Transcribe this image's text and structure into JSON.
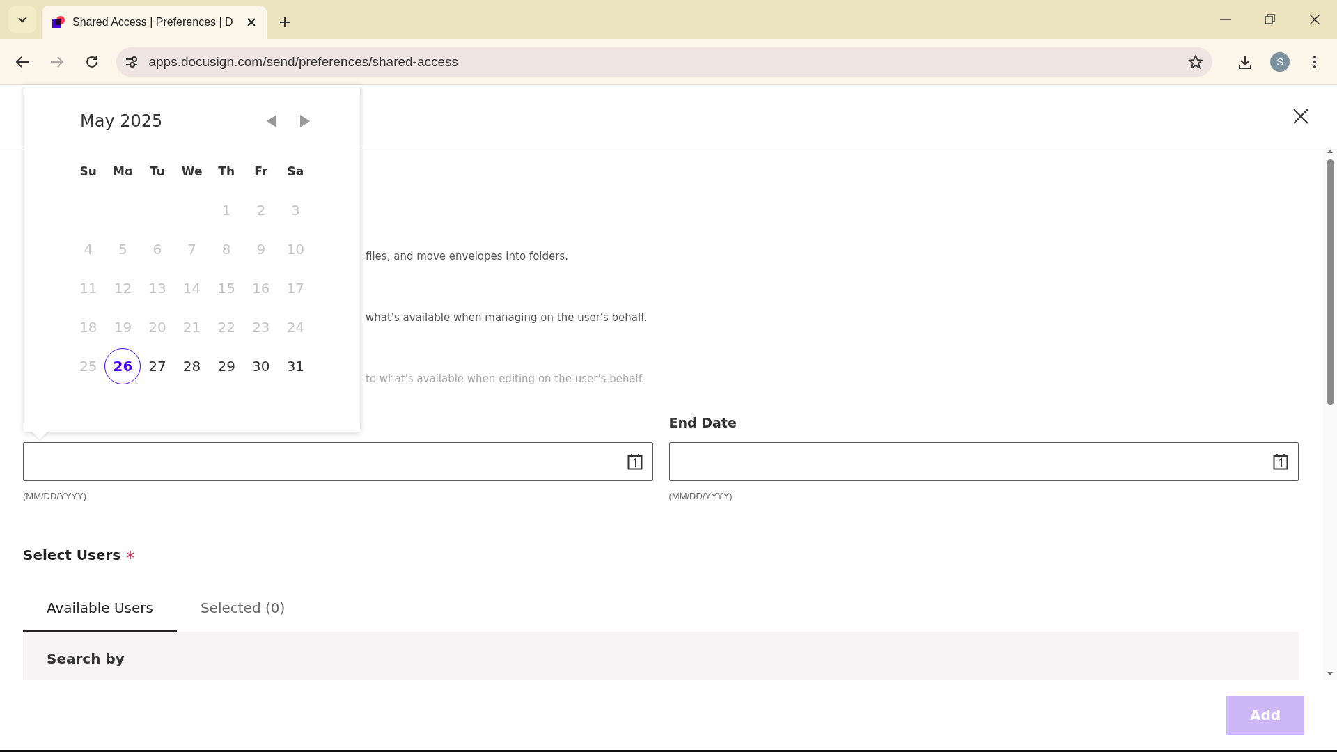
{
  "browser": {
    "tab_title": "Shared Access | Preferences | D",
    "address": "apps.docusign.com/send/preferences/shared-access",
    "profile_initial": "S"
  },
  "calendar": {
    "month_title": "May 2025",
    "weekdays": [
      "Su",
      "Mo",
      "Tu",
      "We",
      "Th",
      "Fr",
      "Sa"
    ],
    "weeks": [
      {
        "days": [
          {
            "kind": "blank"
          },
          {
            "kind": "blank"
          },
          {
            "kind": "blank"
          },
          {
            "kind": "blank"
          },
          {
            "kind": "day",
            "label": "1",
            "disabled": true,
            "selected": false
          },
          {
            "kind": "day",
            "label": "2",
            "disabled": true,
            "selected": false
          },
          {
            "kind": "day",
            "label": "3",
            "disabled": true,
            "selected": false
          }
        ]
      },
      {
        "days": [
          {
            "kind": "day",
            "label": "4",
            "disabled": true,
            "selected": false
          },
          {
            "kind": "day",
            "label": "5",
            "disabled": true,
            "selected": false
          },
          {
            "kind": "day",
            "label": "6",
            "disabled": true,
            "selected": false
          },
          {
            "kind": "day",
            "label": "7",
            "disabled": true,
            "selected": false
          },
          {
            "kind": "day",
            "label": "8",
            "disabled": true,
            "selected": false
          },
          {
            "kind": "day",
            "label": "9",
            "disabled": true,
            "selected": false
          },
          {
            "kind": "day",
            "label": "10",
            "disabled": true,
            "selected": false
          }
        ]
      },
      {
        "days": [
          {
            "kind": "day",
            "label": "11",
            "disabled": true,
            "selected": false
          },
          {
            "kind": "day",
            "label": "12",
            "disabled": true,
            "selected": false
          },
          {
            "kind": "day",
            "label": "13",
            "disabled": true,
            "selected": false
          },
          {
            "kind": "day",
            "label": "14",
            "disabled": true,
            "selected": false
          },
          {
            "kind": "day",
            "label": "15",
            "disabled": true,
            "selected": false
          },
          {
            "kind": "day",
            "label": "16",
            "disabled": true,
            "selected": false
          },
          {
            "kind": "day",
            "label": "17",
            "disabled": true,
            "selected": false
          }
        ]
      },
      {
        "days": [
          {
            "kind": "day",
            "label": "18",
            "disabled": true,
            "selected": false
          },
          {
            "kind": "day",
            "label": "19",
            "disabled": true,
            "selected": false
          },
          {
            "kind": "day",
            "label": "20",
            "disabled": true,
            "selected": false
          },
          {
            "kind": "day",
            "label": "21",
            "disabled": true,
            "selected": false
          },
          {
            "kind": "day",
            "label": "22",
            "disabled": true,
            "selected": false
          },
          {
            "kind": "day",
            "label": "23",
            "disabled": true,
            "selected": false
          },
          {
            "kind": "day",
            "label": "24",
            "disabled": true,
            "selected": false
          }
        ]
      },
      {
        "days": [
          {
            "kind": "day",
            "label": "25",
            "disabled": true,
            "selected": false
          },
          {
            "kind": "day",
            "label": "26",
            "disabled": false,
            "selected": true
          },
          {
            "kind": "day",
            "label": "27",
            "disabled": false,
            "selected": false
          },
          {
            "kind": "day",
            "label": "28",
            "disabled": false,
            "selected": false
          },
          {
            "kind": "day",
            "label": "29",
            "disabled": false,
            "selected": false
          },
          {
            "kind": "day",
            "label": "30",
            "disabled": false,
            "selected": false
          },
          {
            "kind": "day",
            "label": "31",
            "disabled": false,
            "selected": false
          }
        ]
      }
    ]
  },
  "descriptions": [
    {
      "text": "files, and move envelopes into folders.",
      "faded": false
    },
    {
      "text": "what's available when managing on the user's behalf.",
      "faded": false
    },
    {
      "text": "to what's available when editing on the user's behalf.",
      "faded": true
    }
  ],
  "start_date": {
    "hint": "(MM/DD/YYYY)"
  },
  "end_date": {
    "label": "End Date",
    "hint": "(MM/DD/YYYY)"
  },
  "select_users": {
    "label": "Select Users",
    "required": true,
    "tabs": [
      {
        "label": "Available Users",
        "selected": true
      },
      {
        "label": "Selected (0)",
        "selected": false
      }
    ],
    "search_label": "Search by"
  },
  "add_button": {
    "label": "Add",
    "disabled": true
  }
}
